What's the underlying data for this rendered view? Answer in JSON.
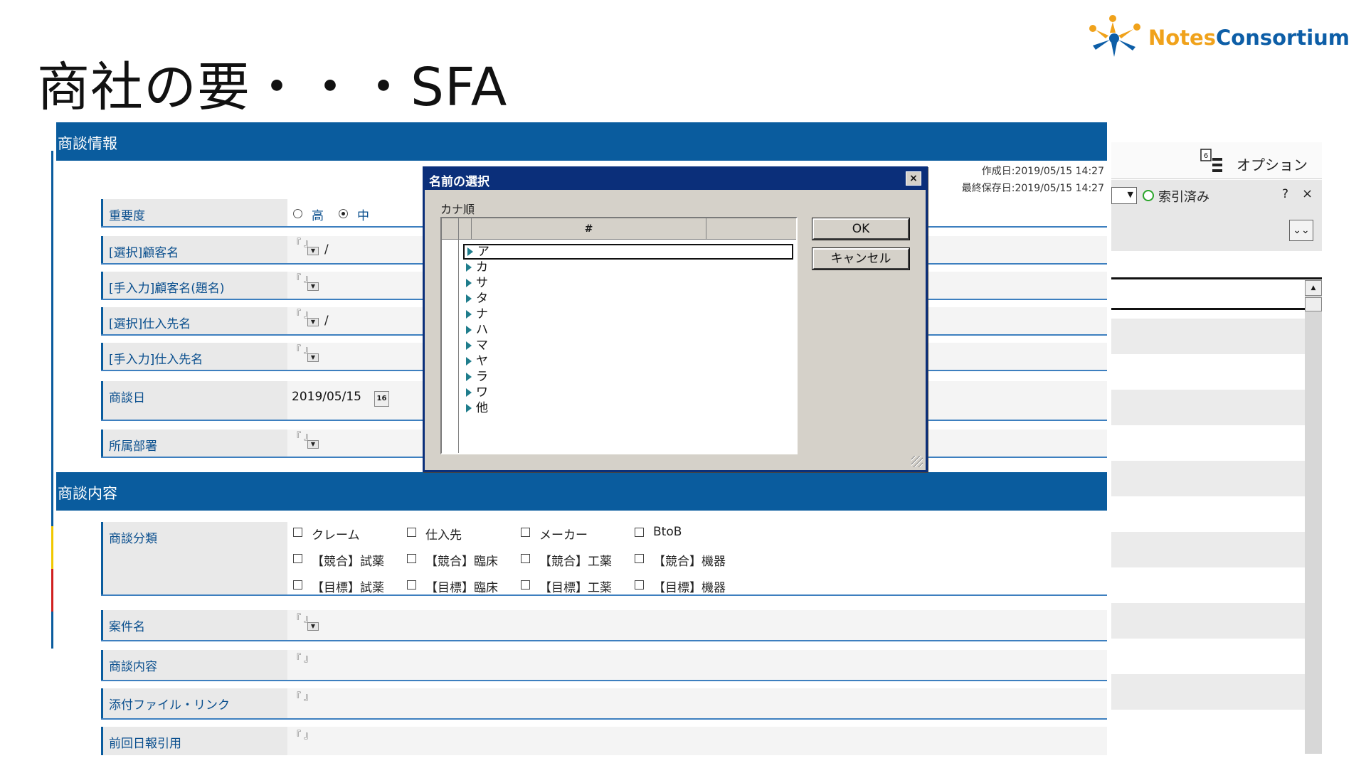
{
  "slide": {
    "title": "商社の要・・・SFA",
    "logo_part1": "Notes",
    "logo_part2": "Consortium"
  },
  "form": {
    "section1_title": "商談情報",
    "created": "作成日:2019/05/15 14:27",
    "last_saved": "最終保存日:2019/05/15 14:27",
    "rows": {
      "importance": "重要度",
      "customer_select": "[選択]顧客名",
      "customer_manual": "[手入力]顧客名(題名)",
      "supplier_select": "[選択]仕入先名",
      "supplier_manual": "[手入力]仕入先名",
      "meeting_date": "商談日",
      "department": "所属部署",
      "category": "商談分類",
      "project": "案件名",
      "content": "商談内容",
      "attachment": "添付ファイル・リンク",
      "previous": "前回日報引用"
    },
    "importance_options": [
      "高",
      "中"
    ],
    "date_value": "2019/05/15",
    "cal_label": "16",
    "slash": "/",
    "field_mark": "『 』",
    "section2_title": "商談内容",
    "categories": [
      [
        "クレーム",
        "仕入先",
        "メーカー",
        "BtoB"
      ],
      [
        "【競合】試薬",
        "【競合】臨床",
        "【競合】工薬",
        "【競合】機器"
      ],
      [
        "【目標】試薬",
        "【目標】臨床",
        "【目標】工薬",
        "【目標】機器"
      ]
    ]
  },
  "notes_panel": {
    "option_label": "オプション",
    "option_badge": "6",
    "indexed_label": "索引済み",
    "help": "?",
    "close": "×",
    "expand": "⌄⌄"
  },
  "dialog": {
    "title": "名前の選択",
    "subtitle": "カナ順",
    "column_header": "#",
    "kana": [
      "ア",
      "カ",
      "サ",
      "タ",
      "ナ",
      "ハ",
      "マ",
      "ヤ",
      "ラ",
      "ワ",
      "他"
    ],
    "ok_label": "OK",
    "cancel_label": "キャンセル",
    "close_label": "×"
  },
  "colors": {
    "section_header": "#0a5c9e",
    "dialog_titlebar": "#0b2f7a",
    "dialog_body": "#d5d1c9",
    "logo_orange": "#f0a21b",
    "logo_blue": "#0d5ea7"
  }
}
